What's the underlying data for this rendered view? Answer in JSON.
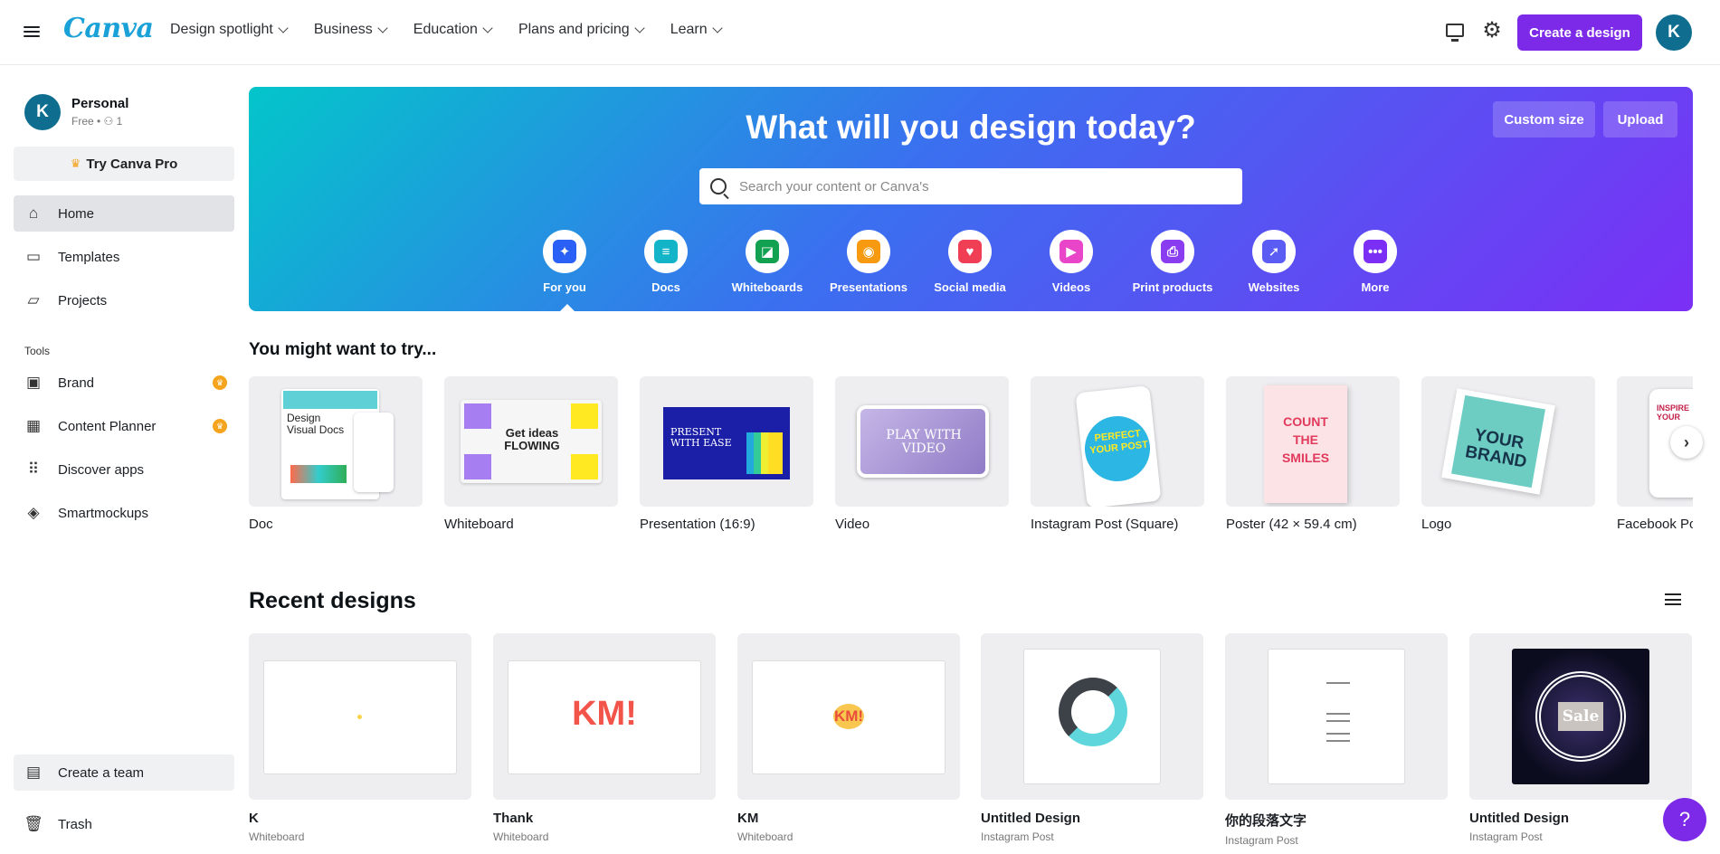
{
  "header": {
    "logo": "Canva",
    "nav": [
      "Design spotlight",
      "Business",
      "Education",
      "Plans and pricing",
      "Learn"
    ],
    "create_label": "Create a design",
    "avatar_letter": "K"
  },
  "sidebar": {
    "account_name": "Personal",
    "account_sub": "Free • ⚇ 1",
    "avatar_letter": "K",
    "try_pro": "Try Canva Pro",
    "items": [
      {
        "label": "Home",
        "icon": "home-icon"
      },
      {
        "label": "Templates",
        "icon": "templates-icon"
      },
      {
        "label": "Projects",
        "icon": "folder-icon"
      }
    ],
    "tools_label": "Tools",
    "tools": [
      {
        "label": "Brand",
        "icon": "brand-icon"
      },
      {
        "label": "Content Planner",
        "icon": "calendar-icon"
      },
      {
        "label": "Discover apps",
        "icon": "apps-grid-icon"
      },
      {
        "label": "Smartmockups",
        "icon": "layers-icon"
      }
    ],
    "bottom": [
      {
        "label": "Create a team",
        "icon": "team-icon"
      },
      {
        "label": "Trash",
        "icon": "trash-icon"
      }
    ]
  },
  "hero": {
    "title": "What will you design today?",
    "custom_size": "Custom size",
    "upload": "Upload",
    "search_placeholder": "Search your content or Canva's",
    "categories": [
      {
        "label": "For you",
        "color": "#2a60f6"
      },
      {
        "label": "Docs",
        "color": "#13b4c7"
      },
      {
        "label": "Whiteboards",
        "color": "#12a150"
      },
      {
        "label": "Presentations",
        "color": "#f79a10"
      },
      {
        "label": "Social media",
        "color": "#f03e55"
      },
      {
        "label": "Videos",
        "color": "#e845c9"
      },
      {
        "label": "Print products",
        "color": "#8a3cf0"
      },
      {
        "label": "Websites",
        "color": "#5a5cf4"
      },
      {
        "label": "More",
        "color": "#7b2ff5"
      }
    ]
  },
  "try_section": {
    "heading": "You might want to try...",
    "cards": [
      {
        "label": "Doc",
        "thumb": "Design Visual Docs"
      },
      {
        "label": "Whiteboard",
        "thumb": "Get ideas FLOWING"
      },
      {
        "label": "Presentation (16:9)",
        "thumb": "PRESENT WITH EASE"
      },
      {
        "label": "Video",
        "thumb": "PLAY WITH VIDEO"
      },
      {
        "label": "Instagram Post (Square)",
        "thumb": "PERFECT YOUR POST"
      },
      {
        "label": "Poster (42 × 59.4 cm)",
        "thumb": "COUNT THE SMILES"
      },
      {
        "label": "Logo",
        "thumb": "YOUR BRAND"
      },
      {
        "label": "Facebook Po",
        "thumb": "INSPIRE YOUR"
      }
    ]
  },
  "recent": {
    "heading": "Recent designs",
    "cards": [
      {
        "title": "K",
        "type": "Whiteboard",
        "thumb": ""
      },
      {
        "title": "Thank",
        "type": "Whiteboard",
        "thumb": "KM!"
      },
      {
        "title": "KM",
        "type": "Whiteboard",
        "thumb": "KM!"
      },
      {
        "title": "Untitled Design",
        "type": "Instagram Post",
        "thumb": ""
      },
      {
        "title": "你的段落文字",
        "type": "Instagram Post",
        "thumb": ""
      },
      {
        "title": "Untitled Design",
        "type": "Instagram Post",
        "thumb": "Sale"
      }
    ]
  },
  "help_label": "?"
}
